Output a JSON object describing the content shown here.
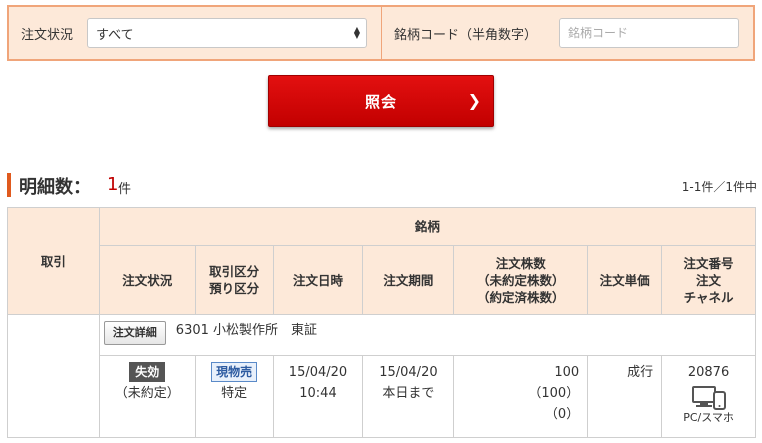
{
  "filter": {
    "status_label": "注文状況",
    "status_value": "すべて",
    "code_label": "銘柄コード（半角数字）",
    "code_placeholder": "銘柄コード"
  },
  "search_button": {
    "label": "照会"
  },
  "summary": {
    "title": "明細数：",
    "count": "1",
    "unit": "件",
    "pagination": "1-1件／1件中"
  },
  "table": {
    "headers": {
      "transaction": "取引",
      "stock": "銘柄",
      "order_status": "注文状況",
      "type_line1": "取引区分",
      "type_line2": "預り区分",
      "order_datetime": "注文日時",
      "period": "注文期間",
      "qty_line1": "注文株数",
      "qty_line2": "（未約定株数）",
      "qty_line3": "（約定済株数）",
      "price": "注文単価",
      "no_line1": "注文番号",
      "no_line2": "注文",
      "no_line3": "チャネル"
    },
    "row": {
      "detail_button": "注文詳細",
      "stock": "6301 小松製作所　東証",
      "status_badge": "失効",
      "status_sub": "（未約定）",
      "type_badge": "現物売",
      "account": "特定",
      "date": "15/04/20",
      "time": "10:44",
      "period_date": "15/04/20",
      "period_text": "本日まで",
      "qty": "100",
      "qty_unfilled": "（100）",
      "qty_filled": "（0）",
      "price": "成行",
      "order_no": "20876",
      "channel": "PC/スマホ"
    }
  },
  "colors": {
    "accent": "#e05a1e",
    "header_bg": "#fde9d9",
    "button_red": "#d40000",
    "count_red": "#c00000"
  }
}
